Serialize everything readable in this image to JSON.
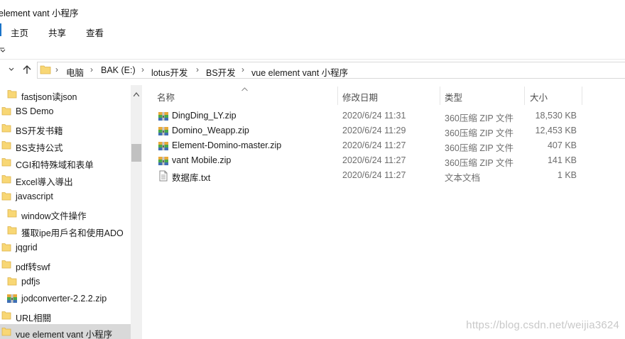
{
  "window": {
    "title": "element vant 小程序"
  },
  "ribbon": {
    "tabs": [
      "主页",
      "共享",
      "查看"
    ]
  },
  "address": {
    "crumbs": [
      "电脑",
      "BAK (E:)",
      "lotus开发",
      "BS开发",
      "vue element vant 小程序"
    ],
    "separator": "›"
  },
  "nav_pane": {
    "items": [
      {
        "label": "fastjson读json",
        "icon": "folder-icon"
      },
      {
        "label": "BS Demo",
        "icon": "folder-icon"
      },
      {
        "label": "BS开发书籍",
        "icon": "folder-icon"
      },
      {
        "label": "BS支持公式",
        "icon": "folder-icon"
      },
      {
        "label": "CGI和特殊域和表单",
        "icon": "folder-icon"
      },
      {
        "label": "Excel導入導出",
        "icon": "folder-icon"
      },
      {
        "label": "javascript",
        "icon": "folder-icon"
      },
      {
        "label": "window文件操作",
        "icon": "folder-icon"
      },
      {
        "label": "獲取ipe用戶名和使用ADO",
        "icon": "folder-icon"
      },
      {
        "label": "jqgrid",
        "icon": "folder-icon"
      },
      {
        "label": "pdf转swf",
        "icon": "folder-icon"
      },
      {
        "label": "pdfjs",
        "icon": "folder-icon"
      },
      {
        "label": "jodconverter-2.2.2.zip",
        "icon": "zip-archive-icon"
      },
      {
        "label": "URL相關",
        "icon": "folder-icon"
      },
      {
        "label": "vue element vant 小程序",
        "icon": "folder-icon",
        "selected": true
      }
    ]
  },
  "file_list": {
    "columns": {
      "name": "名称",
      "date": "修改日期",
      "type": "类型",
      "size": "大小"
    },
    "rows": [
      {
        "name": "DingDing_LY.zip",
        "date": "2020/6/24 11:31",
        "type": "360压缩 ZIP 文件",
        "size": "18,530 KB",
        "icon": "zip-archive-icon"
      },
      {
        "name": "Domino_Weapp.zip",
        "date": "2020/6/24 11:29",
        "type": "360压缩 ZIP 文件",
        "size": "12,453 KB",
        "icon": "zip-archive-icon"
      },
      {
        "name": "Element-Domino-master.zip",
        "date": "2020/6/24 11:27",
        "type": "360压缩 ZIP 文件",
        "size": "407 KB",
        "icon": "zip-archive-icon"
      },
      {
        "name": "vant Mobile.zip",
        "date": "2020/6/24 11:27",
        "type": "360压缩 ZIP 文件",
        "size": "141 KB",
        "icon": "zip-archive-icon"
      },
      {
        "name": "数据库.txt",
        "date": "2020/6/24 11:27",
        "type": "文本文档",
        "size": "1 KB",
        "icon": "text-file-icon"
      }
    ]
  },
  "watermark": {
    "text": "https://blog.csdn.net/weijia3624"
  },
  "colors": {
    "accent": "#1a73c8",
    "folder": "#f8d775",
    "selection": "#d9d9d9"
  }
}
